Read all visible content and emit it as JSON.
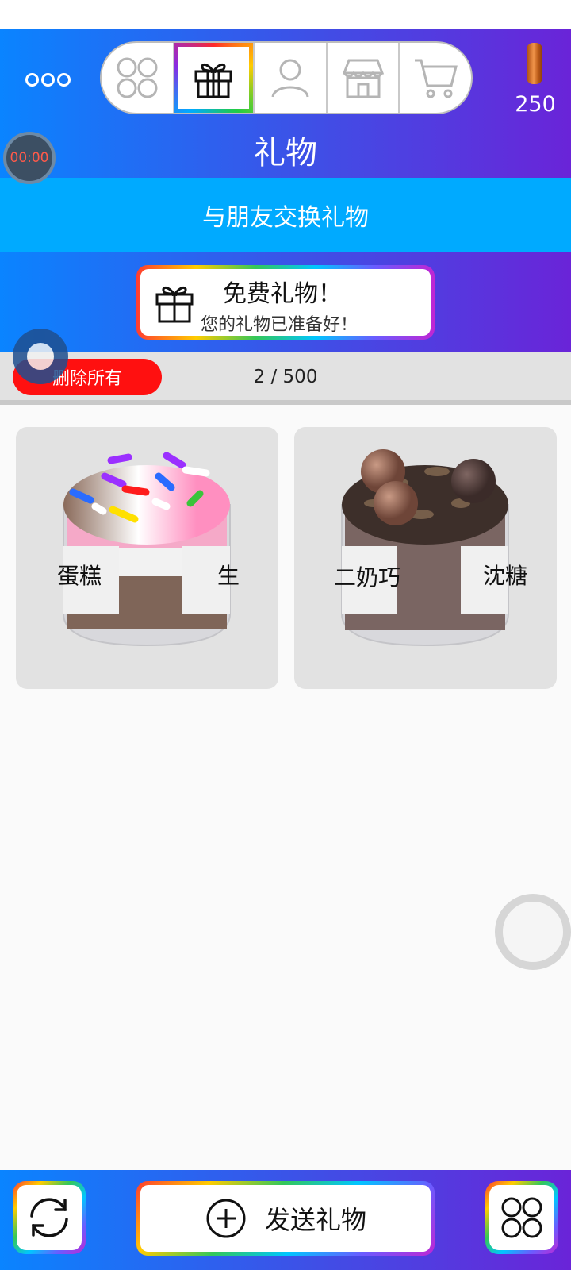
{
  "header": {
    "title": "礼物",
    "coins": "250",
    "exchange_banner": "与朋友交换礼物",
    "timer": "00:00"
  },
  "tabs": [
    {
      "name": "home-grid",
      "icon": "grid-icon",
      "active": false
    },
    {
      "name": "gifts",
      "icon": "gift-icon",
      "active": true
    },
    {
      "name": "profile",
      "icon": "person-icon",
      "active": false
    },
    {
      "name": "shop",
      "icon": "store-icon",
      "active": false
    },
    {
      "name": "cart",
      "icon": "cart-icon",
      "active": false
    }
  ],
  "free_gift": {
    "title": "免费礼物！",
    "subtitle": "您的礼物已准备好！"
  },
  "list": {
    "delete_all": "删除所有",
    "count": "2 / 500"
  },
  "gifts": [
    {
      "label_left": "蛋糕",
      "label_right": "生",
      "kind": "sprinkle-cake-jar"
    },
    {
      "label_left": "二奶巧",
      "label_right": "沈糖",
      "kind": "chocolate-ball-jar"
    }
  ],
  "bottom": {
    "send_label": "发送礼物"
  },
  "colors": {
    "header_start": "#0a84ff",
    "header_end": "#6a24d8",
    "banner": "#00aaff",
    "delete": "#ff1010"
  }
}
